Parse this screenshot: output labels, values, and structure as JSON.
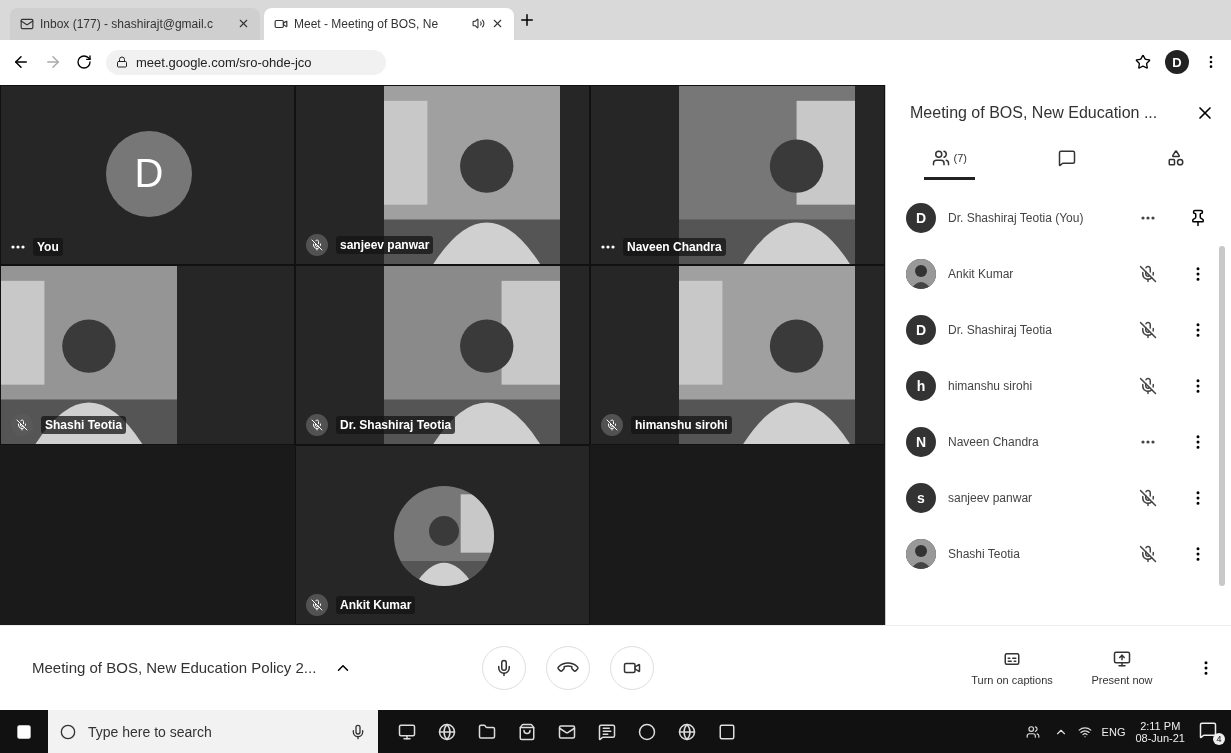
{
  "browser": {
    "tabs": [
      {
        "title": "Inbox (177) - shashirajt@gmail.c",
        "selected": false,
        "audio": false
      },
      {
        "title": "Meet - Meeting of BOS, Ne",
        "selected": true,
        "audio": true
      }
    ],
    "url": "meet.google.com/sro-ohde-jco",
    "profile_initial": "D"
  },
  "tiles": [
    {
      "name": "You",
      "kind": "avatar",
      "initial": "D",
      "muted": false
    },
    {
      "name": "sanjeev panwar",
      "kind": "video",
      "muted": true
    },
    {
      "name": "Naveen Chandra",
      "kind": "video",
      "muted": false
    },
    {
      "name": "Shashi Teotia",
      "kind": "video",
      "muted": true
    },
    {
      "name": "Dr. Shashiraj Teotia",
      "kind": "video",
      "muted": true
    },
    {
      "name": "himanshu sirohi",
      "kind": "video",
      "muted": true
    },
    {
      "name": "Ankit Kumar",
      "muted": true
    }
  ],
  "panel": {
    "title": "Meeting of BOS, New Education ...",
    "tabs": [
      {
        "kind": "people",
        "count": "(7)",
        "selected": true
      },
      {
        "kind": "chat",
        "selected": false
      },
      {
        "kind": "activities",
        "selected": false
      }
    ],
    "participants": [
      {
        "name": "Dr. Shashiraj Teotia (You)",
        "kind": "initial",
        "initial": "D",
        "muted": false,
        "is_self": true
      },
      {
        "name": "Ankit Kumar",
        "muted": true,
        "is_self": false
      },
      {
        "name": "Dr. Shashiraj Teotia",
        "kind": "initial",
        "initial": "D",
        "muted": true,
        "is_self": false
      },
      {
        "name": "himanshu sirohi",
        "kind": "initial",
        "initial": "h",
        "muted": true,
        "is_self": false
      },
      {
        "name": "Naveen Chandra",
        "kind": "initial",
        "initial": "N",
        "muted": false,
        "is_self": false
      },
      {
        "name": "sanjeev panwar",
        "kind": "initial",
        "initial": "s",
        "muted": true,
        "is_self": false
      },
      {
        "name": "Shashi Teotia",
        "muted": true,
        "is_self": false
      }
    ]
  },
  "bottom_bar": {
    "meeting_title": "Meeting of BOS, New Education Policy 2...",
    "captions_label": "Turn on captions",
    "present_label": "Present now"
  },
  "taskbar": {
    "search_placeholder": "Type here to search",
    "language": "ENG",
    "time": "2:11 PM",
    "date": "08-Jun-21",
    "notifications": "4"
  }
}
